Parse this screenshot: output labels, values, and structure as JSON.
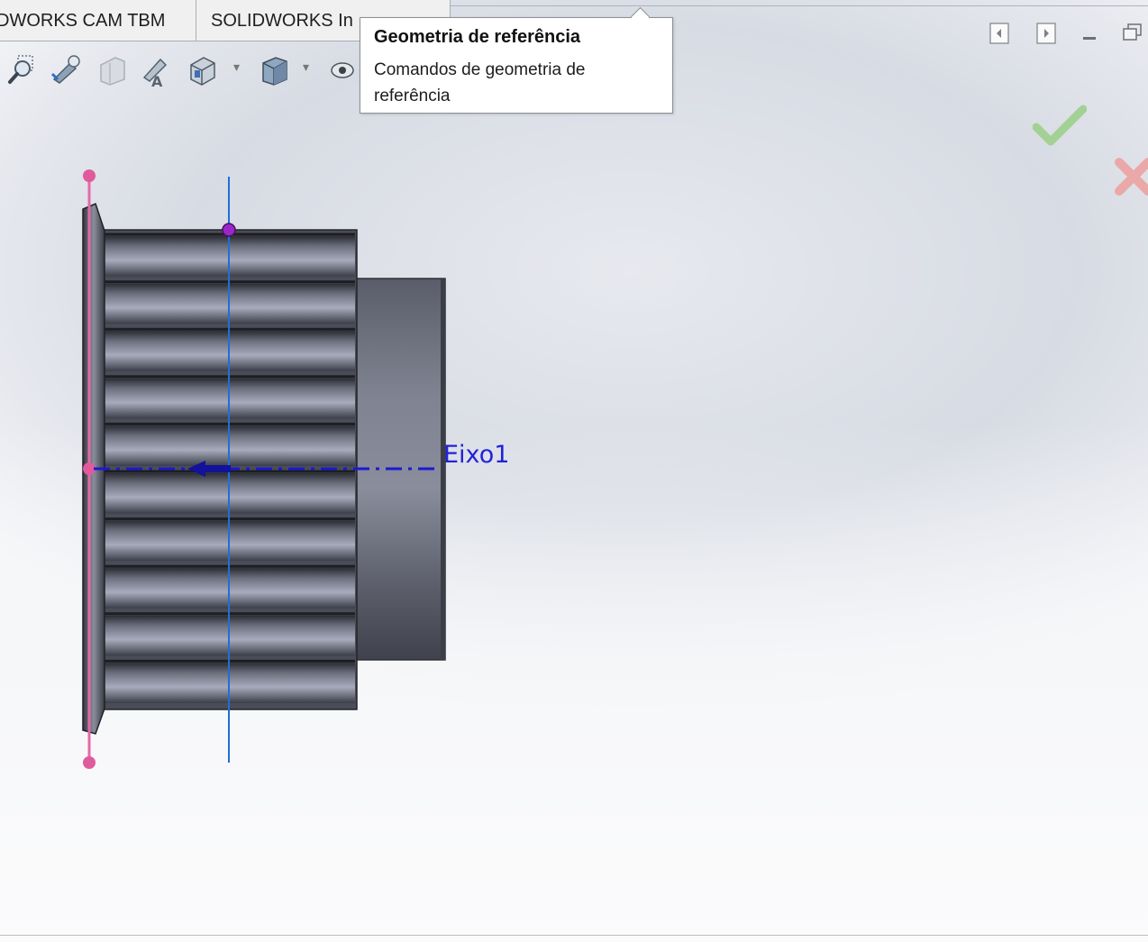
{
  "tabs": [
    {
      "label": "DWORKS CAM TBM"
    },
    {
      "label": "SOLIDWORKS In"
    }
  ],
  "toolbar": {
    "icons": [
      "zoom-to-area-icon",
      "previous-view-icon",
      "section-view-icon",
      "dynamic-annotation-icon",
      "view-orientation-icon",
      "display-style-icon",
      "hide-show-items-icon"
    ]
  },
  "tooltip": {
    "title": "Geometria de referência",
    "description": "Comandos de geometria de referência"
  },
  "window_controls": [
    "panel-left-icon",
    "panel-right-icon",
    "minimize-icon",
    "restore-icon"
  ],
  "confirm_corner": {
    "ok": "check-icon",
    "cancel": "close-icon"
  },
  "model": {
    "axis_label": "Eixo1",
    "colors": {
      "axis": "#1a1ad4",
      "sketch_line": "#e26aa6",
      "vertical_line": "#1f6fd6",
      "point": "#9b27c9"
    }
  }
}
